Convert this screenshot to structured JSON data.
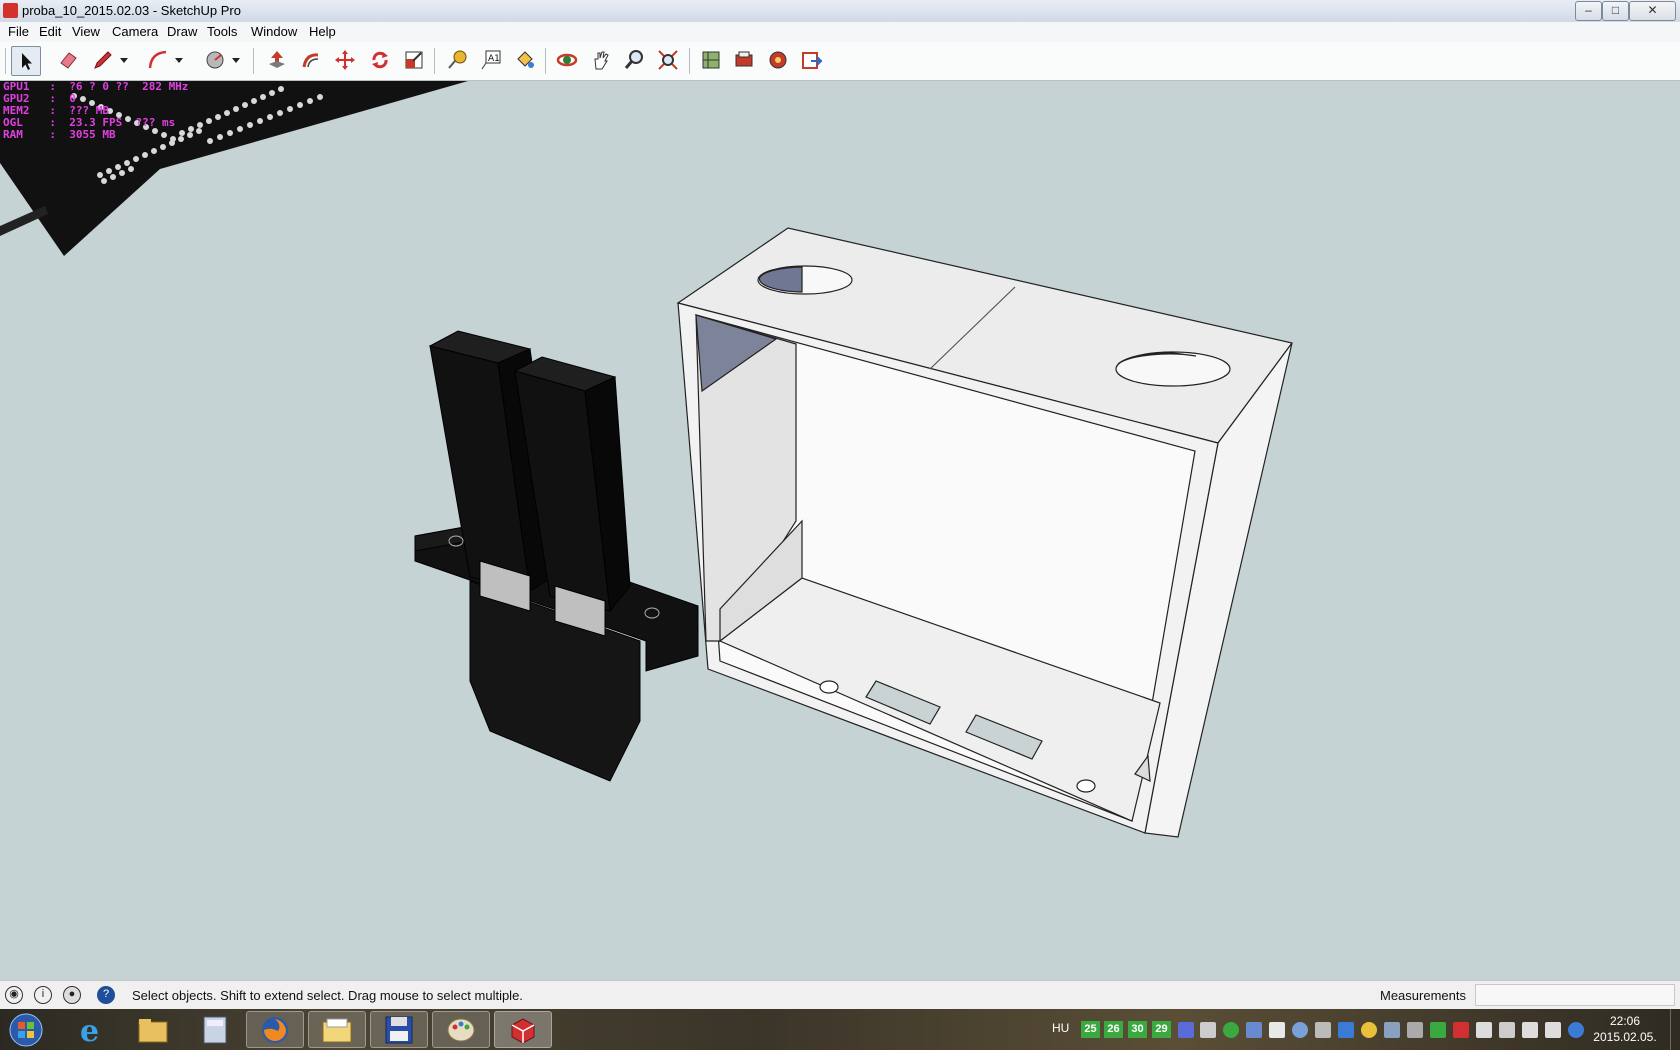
{
  "window": {
    "title": "proba_10_2015.02.03 - SketchUp Pro",
    "minimize": "–",
    "maximize": "□",
    "close": "✕"
  },
  "menu": [
    "File",
    "Edit",
    "View",
    "Camera",
    "Draw",
    "Tools",
    "Window",
    "Help"
  ],
  "toolbar": {
    "tools": [
      "select-tool",
      "eraser-tool",
      "line-tool",
      "arc-tool",
      "shapes-tool",
      "push-pull-tool",
      "offset-tool",
      "move-tool",
      "rotate-tool",
      "scale-tool",
      "tape-measure-tool",
      "text-tool",
      "paint-bucket-tool",
      "orbit-tool",
      "pan-tool",
      "zoom-tool",
      "zoom-extents-tool",
      "3d-warehouse-tool",
      "extension-warehouse-tool",
      "layout-tool",
      "send-to-layout-tool"
    ]
  },
  "overlay_stats": {
    "lines": [
      "GPU1   :  ?6 ? 0 ??  282 MHz",
      "GPU2   :  0",
      "MEM2   :  ??? MB",
      "OGL    :  23.3 FPS  ??? ms",
      "RAM    :  3055 MB"
    ]
  },
  "status": {
    "hint": "Select objects. Shift to extend select. Drag mouse to select multiple.",
    "measurements_label": "Measurements",
    "measurements_value": ""
  },
  "taskbar": {
    "apps": [
      "start-button",
      "internet-explorer",
      "file-explorer",
      "calculator",
      "firefox",
      "folder",
      "save-app",
      "paint",
      "sketchup"
    ],
    "language": "HU",
    "badges": [
      "25",
      "26",
      "30",
      "29"
    ],
    "time": "22:06",
    "date": "2015.02.05."
  },
  "colors": {
    "viewport_bg": "#c6d3d4",
    "stats_text": "#e040e0",
    "model_white": "#f4f6f6",
    "model_black": "#141414"
  }
}
